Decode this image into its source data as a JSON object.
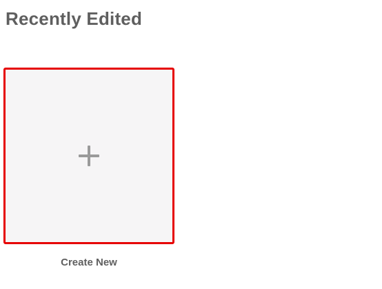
{
  "section": {
    "title": "Recently Edited"
  },
  "create_card": {
    "icon": "plus-icon",
    "caption": "Create New",
    "border_color": "#e60000",
    "background_color": "#f6f5f6"
  }
}
